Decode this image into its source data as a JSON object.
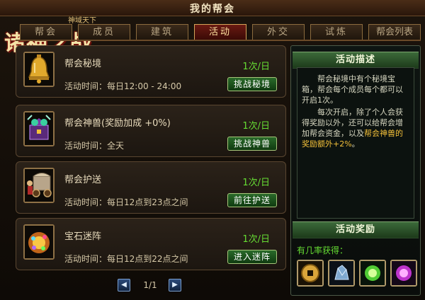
{
  "window": {
    "title": "我的帮会"
  },
  "logo": {
    "main": "诸神之战",
    "sub": "神域天下"
  },
  "tabs": [
    {
      "label": "帮会"
    },
    {
      "label": "成员"
    },
    {
      "label": "建筑"
    },
    {
      "label": "活动",
      "active": true
    },
    {
      "label": "外交"
    },
    {
      "label": "试炼"
    },
    {
      "label": "帮会列表"
    }
  ],
  "activities": [
    {
      "name": "帮会秘境",
      "freq": "1次/日",
      "time": "活动时间：每日12:00 - 24:00",
      "button": "挑战秘境",
      "icon": "bell-icon"
    },
    {
      "name": "帮会神兽(奖励加成 +0%)",
      "freq": "1次/日",
      "time": "活动时间：全天",
      "button": "挑战神兽",
      "icon": "beast-chest-icon"
    },
    {
      "name": "帮会护送",
      "freq": "1次/日",
      "time": "活动时间：每日12点到23点之间",
      "button": "前往护送",
      "icon": "cart-icon"
    },
    {
      "name": "宝石迷阵",
      "freq": "1次/日",
      "time": "活动时间：每日12点到22点之间",
      "button": "进入迷阵",
      "icon": "gems-icon"
    }
  ],
  "pager": {
    "text": "1/1",
    "prev_icon": "prev-arrow-icon",
    "next_icon": "next-arrow-icon"
  },
  "description": {
    "heading": "活动描述",
    "p1": "帮会秘境中有个秘境宝箱，帮会每个成员每个都可以开启1次。",
    "p2_a": "每次开启，除了个人会获得奖励以外，还可以给帮会增加帮会资金，以及",
    "p2_hl": "帮会神兽的奖励额外+2%",
    "p2_b": "。"
  },
  "rewards": {
    "heading": "活动奖励",
    "label": "有几率获得：",
    "items": [
      "coin-icon",
      "crystal-ore-icon",
      "green-gem-icon",
      "purple-gem-icon"
    ]
  },
  "colors": {
    "accent_green": "#66dd33",
    "highlight_gold": "#f3c03a",
    "active_tab": "#6a1a12"
  }
}
